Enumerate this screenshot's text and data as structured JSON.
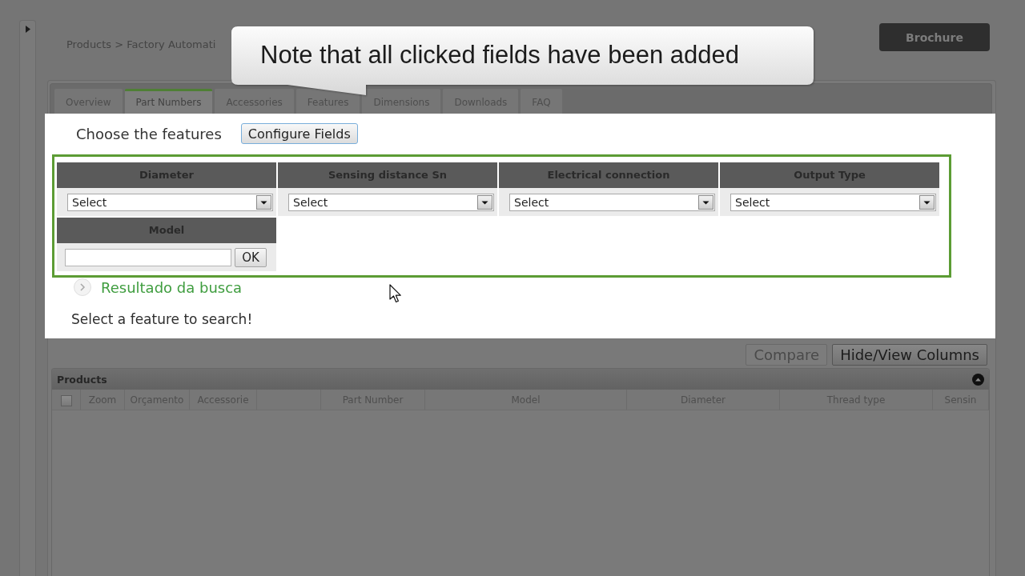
{
  "breadcrumb": "Products > Factory Automati",
  "brochure_button": "Brochure",
  "callout": {
    "text": "Note that all clicked fields have been added"
  },
  "tabs": [
    {
      "label": "Overview",
      "selected": false
    },
    {
      "label": "Part Numbers",
      "selected": true
    },
    {
      "label": "Accessories",
      "selected": false
    },
    {
      "label": "Features",
      "selected": false
    },
    {
      "label": "Dimensions",
      "selected": false
    },
    {
      "label": "Downloads",
      "selected": false
    },
    {
      "label": "FAQ",
      "selected": false
    }
  ],
  "feature_chooser": {
    "label": "Choose the features",
    "button": "Configure Fields"
  },
  "filters": [
    {
      "kind": "select",
      "label": "Diameter",
      "value": "Select"
    },
    {
      "kind": "select",
      "label": "Sensing distance Sn",
      "value": "Select"
    },
    {
      "kind": "select",
      "label": "Electrical connection",
      "value": "Select"
    },
    {
      "kind": "select",
      "label": "Output Type",
      "value": "Select"
    },
    {
      "kind": "text",
      "label": "Model",
      "button": "OK"
    }
  ],
  "results": {
    "heading": "Resultado da busca",
    "message": "Select a feature to search!"
  },
  "actions": [
    {
      "label": "Compare",
      "disabled": true
    },
    {
      "label": "Hide/View Columns",
      "disabled": false
    }
  ],
  "products": {
    "title": "Products",
    "columns": [
      {
        "kind": "checkbox",
        "checked": false
      },
      {
        "kind": "text",
        "label": "Zoom"
      },
      {
        "kind": "text",
        "label": "Orçamento"
      },
      {
        "kind": "text",
        "label": "Accessorie"
      },
      {
        "kind": "blank"
      },
      {
        "kind": "text",
        "label": "Part Number"
      },
      {
        "kind": "text",
        "label": "Model"
      },
      {
        "kind": "text",
        "label": "Diameter"
      },
      {
        "kind": "text",
        "label": "Thread type"
      },
      {
        "kind": "text",
        "label": "Sensin"
      }
    ]
  }
}
